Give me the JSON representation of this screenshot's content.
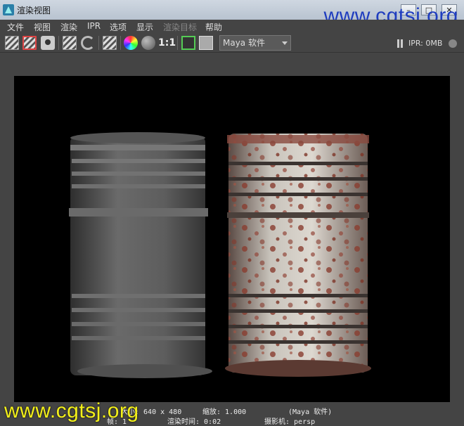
{
  "window": {
    "title": "渲染视图",
    "buttons": {
      "minimize": "–",
      "maximize": "□",
      "close": "✕"
    }
  },
  "watermarks": {
    "top": "www.cgtsj.org",
    "bottom": "www.cgtsj.org"
  },
  "menu": [
    "文件",
    "视图",
    "渲染",
    "IPR",
    "选项",
    "显示",
    "渲染目标",
    "帮助"
  ],
  "toolbar": {
    "ratio_label": "1:1",
    "renderer": "Maya 软件",
    "ipr_status": "IPR: 0MB",
    "icons": [
      "redo-render-icon",
      "render-region-icon",
      "snapshot-icon",
      "ipr-render-icon",
      "refresh-icon",
      "render-settings-icon",
      "rgb-channels-icon",
      "alpha-channel-icon",
      "real-size-icon",
      "frame-image-icon",
      "keep-image-icon"
    ]
  },
  "status": {
    "size": "大小: 640 x 480",
    "zoom": "缩放: 1.000",
    "renderer": "(Maya 软件)",
    "frame": "帧: 1",
    "render_time": "渲染时间: 0:02",
    "camera": "摄影机: persp"
  },
  "colors": {
    "titlebar": "#c3cdd9",
    "background": "#444444",
    "canvas": "#000000",
    "watermark_top": "#1f3dbf",
    "watermark_bottom": "#f3f01a"
  }
}
